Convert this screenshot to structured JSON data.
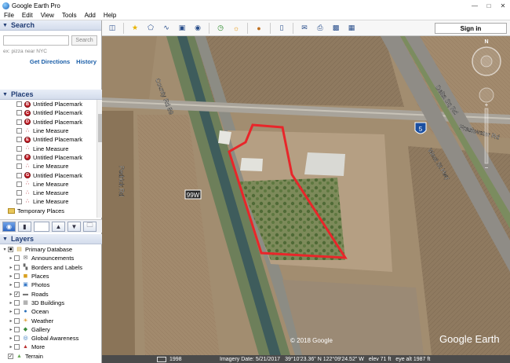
{
  "window": {
    "title": "Google Earth Pro"
  },
  "menu": [
    "File",
    "Edit",
    "View",
    "Tools",
    "Add",
    "Help"
  ],
  "search": {
    "header": "Search",
    "placeholder": "",
    "button": "Search",
    "hint": "ex: pizza near NYC",
    "get_directions": "Get Directions",
    "history": "History"
  },
  "places": {
    "header": "Places",
    "items": [
      {
        "type": "placemark",
        "letter": "B",
        "label": "Untitled Placemark"
      },
      {
        "type": "placemark",
        "letter": "C",
        "label": "Untitled Placemark"
      },
      {
        "type": "placemark",
        "letter": "D",
        "label": "Untitled Placemark"
      },
      {
        "type": "measure",
        "label": "Line Measure"
      },
      {
        "type": "placemark",
        "letter": "E",
        "label": "Untitled Placemark"
      },
      {
        "type": "measure",
        "label": "Line Measure"
      },
      {
        "type": "placemark",
        "letter": "F",
        "label": "Untitled Placemark"
      },
      {
        "type": "measure",
        "label": "Line Measure"
      },
      {
        "type": "placemark",
        "letter": "G",
        "label": "Untitled Placemark"
      },
      {
        "type": "measure",
        "label": "Line Measure"
      },
      {
        "type": "measure",
        "label": "Line Measure"
      },
      {
        "type": "measure",
        "label": "Line Measure"
      }
    ],
    "temporary": "Temporary Places"
  },
  "layers": {
    "header": "Layers",
    "items": [
      {
        "label": "Primary Database",
        "icon": "database-icon",
        "checked": "partial",
        "level": 0
      },
      {
        "label": "Announcements",
        "icon": "announcement-icon",
        "checked": false,
        "level": 1
      },
      {
        "label": "Borders and Labels",
        "icon": "borders-icon",
        "checked": false,
        "level": 1
      },
      {
        "label": "Places",
        "icon": "places-icon",
        "checked": false,
        "level": 1
      },
      {
        "label": "Photos",
        "icon": "photos-icon",
        "checked": false,
        "level": 1
      },
      {
        "label": "Roads",
        "icon": "roads-icon",
        "checked": true,
        "level": 1
      },
      {
        "label": "3D Buildings",
        "icon": "buildings-icon",
        "checked": false,
        "level": 1
      },
      {
        "label": "Ocean",
        "icon": "ocean-icon",
        "checked": false,
        "level": 1
      },
      {
        "label": "Weather",
        "icon": "weather-icon",
        "checked": false,
        "level": 1
      },
      {
        "label": "Gallery",
        "icon": "gallery-icon",
        "checked": false,
        "level": 1
      },
      {
        "label": "Global Awareness",
        "icon": "globe-icon",
        "checked": false,
        "level": 1
      },
      {
        "label": "More",
        "icon": "more-icon",
        "checked": false,
        "level": 1
      },
      {
        "label": "Terrain",
        "icon": "terrain-icon",
        "checked": true,
        "level": 0
      }
    ]
  },
  "toolbar": {
    "signin": "Sign in"
  },
  "map": {
    "labels": {
      "road1": "County Rd 89",
      "road2": "Delta Sq Rd",
      "road3": "Freshwater Rd",
      "road4": "West St Hwy",
      "road5": "Pedrick Rd",
      "highway": "99W",
      "interstate": "5",
      "copyright": "© 2018 Google",
      "brand": "Google Earth",
      "north": "N"
    }
  },
  "status": {
    "year": "1998",
    "imagery_date": "Imagery Date: 5/21/2017",
    "coords": "39°10'23.36\" N  122°09'24.52\" W",
    "elev": "elev   71 ft",
    "eye_alt": "eye alt  1987 ft"
  },
  "colors": {
    "boundary": "#e8262a",
    "panel_header": "#1f3b73",
    "link": "#1a5ea8"
  }
}
